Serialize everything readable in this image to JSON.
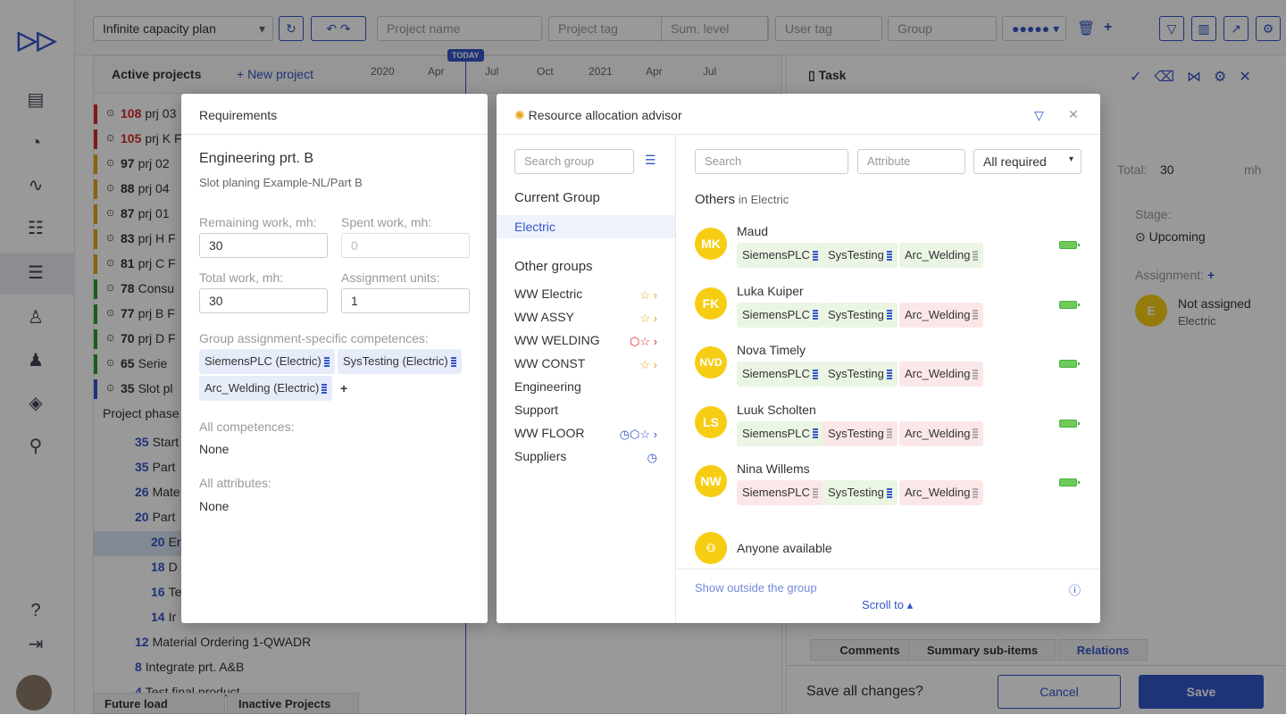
{
  "topbar": {
    "plan": "Infinite capacity plan",
    "project_name_ph": "Project name",
    "project_tag_ph": "Project tag",
    "sum_level_ph": "Sum. level",
    "user_tag_ph": "User tag",
    "group_ph": "Group"
  },
  "gantt": {
    "title": "Active projects",
    "new_project": "+ New project",
    "timeline": [
      "2020",
      "Apr",
      "Jul",
      "Oct",
      "2021",
      "Apr",
      "Jul"
    ],
    "today": "TODAY",
    "rows": [
      {
        "num": "108",
        "name": "prj 03",
        "color": "#d42b2b",
        "num_color": "#d42b2b"
      },
      {
        "num": "105",
        "name": "prj K F",
        "color": "#d42b2b",
        "num_color": "#d42b2b"
      },
      {
        "num": "97",
        "name": "prj 02",
        "color": "#e8a317",
        "num_color": "#333"
      },
      {
        "num": "88",
        "name": "prj 04",
        "color": "#e8a317",
        "num_color": "#333"
      },
      {
        "num": "87",
        "name": "prj 01",
        "color": "#e8a317",
        "num_color": "#333"
      },
      {
        "num": "83",
        "name": "prj H F",
        "color": "#e8a317",
        "num_color": "#333"
      },
      {
        "num": "81",
        "name": "prj C F",
        "color": "#e8a317",
        "num_color": "#333"
      },
      {
        "num": "78",
        "name": "Consu",
        "color": "#2a9d2a",
        "num_color": "#333"
      },
      {
        "num": "77",
        "name": "prj B F",
        "color": "#2a9d2a",
        "num_color": "#333"
      },
      {
        "num": "70",
        "name": "prj D F",
        "color": "#2a9d2a",
        "num_color": "#333"
      },
      {
        "num": "65",
        "name": "Serie",
        "color": "#2a9d2a",
        "num_color": "#333"
      },
      {
        "num": "35",
        "name": "Slot pl",
        "color": "#3455c8",
        "num_color": "#333"
      }
    ],
    "phases_label": "Project phase",
    "sub_rows": [
      {
        "num": "35",
        "name": "Start"
      },
      {
        "num": "35",
        "name": "Part"
      },
      {
        "num": "26",
        "name": "Mate"
      },
      {
        "num": "20",
        "name": "Part"
      },
      {
        "num": "20",
        "name": "Er"
      },
      {
        "num": "18",
        "name": "D"
      },
      {
        "num": "16",
        "name": "Te"
      },
      {
        "num": "14",
        "name": "Ir"
      },
      {
        "num": "12",
        "name": "Material Ordering 1-QWADR"
      },
      {
        "num": "8",
        "name": "Integrate prt. A&B"
      },
      {
        "num": "4",
        "name": "Test final product"
      }
    ]
  },
  "bottom_tabs": [
    "Future load",
    "Inactive Projects"
  ],
  "task_panel": {
    "title": "Task",
    "total_label": "Total:",
    "total_value": "30",
    "total_unit": "mh",
    "stage_label": "Stage:",
    "stage_value": "Upcoming",
    "assignment_label": "Assignment:",
    "not_assigned": "Not assigned",
    "group": "Electric",
    "avatar": "E",
    "tabs": [
      "Comments",
      "Summary sub-items",
      "Relations"
    ],
    "save_prompt": "Save all changes?",
    "cancel": "Cancel",
    "save": "Save"
  },
  "requirements": {
    "header": "Requirements",
    "title": "Engineering prt. B",
    "subtitle": "Slot planing Example-NL/Part B",
    "remaining_label": "Remaining work, mh:",
    "remaining_value": "30",
    "spent_label": "Spent work, mh:",
    "spent_value": "0",
    "total_label": "Total work, mh:",
    "total_value": "30",
    "units_label": "Assignment units:",
    "units_value": "1",
    "group_comp_label": "Group assignment-specific competences:",
    "group_comps": [
      "SiemensPLC (Electric)",
      "SysTesting (Electric)",
      "Arc_Welding (Electric)"
    ],
    "all_comp_label": "All competences:",
    "all_comp_value": "None",
    "all_attr_label": "All attributes:",
    "all_attr_value": "None"
  },
  "advisor": {
    "header": "Resource allocation advisor",
    "search_group_ph": "Search group",
    "current_group_label": "Current Group",
    "current_group": "Electric",
    "other_groups_label": "Other groups",
    "other_groups": [
      "WW Electric",
      "WW ASSY",
      "WW WELDING",
      "WW CONST",
      "Engineering",
      "Support",
      "WW FLOOR",
      "Suppliers"
    ],
    "search_ph": "Search",
    "attribute_ph": "Attribute",
    "filter_value": "All required",
    "others_label": "Others",
    "others_in": "in Electric",
    "people": [
      {
        "initials": "MK",
        "name": "Maud",
        "skills": [
          {
            "name": "SiemensPLC",
            "state": "green"
          },
          {
            "name": "SysTesting",
            "state": "green"
          },
          {
            "name": "Arc_Welding",
            "state": "green"
          }
        ]
      },
      {
        "initials": "FK",
        "name": "Luka Kuiper",
        "skills": [
          {
            "name": "SiemensPLC",
            "state": "green"
          },
          {
            "name": "SysTesting",
            "state": "green"
          },
          {
            "name": "Arc_Welding",
            "state": "red"
          }
        ]
      },
      {
        "initials": "NVD",
        "name": "Nova Timely",
        "skills": [
          {
            "name": "SiemensPLC",
            "state": "green"
          },
          {
            "name": "SysTesting",
            "state": "green"
          },
          {
            "name": "Arc_Welding",
            "state": "red"
          }
        ]
      },
      {
        "initials": "LS",
        "name": "Luuk Scholten",
        "skills": [
          {
            "name": "SiemensPLC",
            "state": "green"
          },
          {
            "name": "SysTesting",
            "state": "red"
          },
          {
            "name": "Arc_Welding",
            "state": "red"
          }
        ]
      },
      {
        "initials": "NW",
        "name": "Nina Willems",
        "skills": [
          {
            "name": "SiemensPLC",
            "state": "red"
          },
          {
            "name": "SysTesting",
            "state": "green"
          },
          {
            "name": "Arc_Welding",
            "state": "red"
          }
        ]
      }
    ],
    "anyone": "Anyone available",
    "show_outside": "Show outside the group",
    "scroll_to": "Scroll to ▴"
  }
}
